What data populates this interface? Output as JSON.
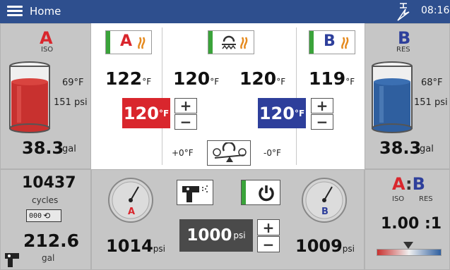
{
  "topbar": {
    "title": "Home",
    "time": "08:16"
  },
  "left_top": {
    "letter": "A",
    "sub": "ISO",
    "temp": "69°F",
    "pressure": "151 psi",
    "volume": "38.3",
    "volume_unit": "gal"
  },
  "right_top": {
    "letter": "B",
    "sub": "RES",
    "temp": "68°F",
    "pressure": "151 psi",
    "volume": "38.3",
    "volume_unit": "gal"
  },
  "center_top": {
    "a_heater_label": "A",
    "b_heater_label": "B",
    "temp_a": "122",
    "temp_hose_a": "120",
    "temp_hose_b": "120",
    "temp_b": "119",
    "unit": "°F",
    "setpoint_a": "120",
    "setpoint_b": "120",
    "plus": "+",
    "minus": "−",
    "offset_a": "+0°F",
    "offset_b": "-0°F"
  },
  "left_bot": {
    "cycles": "10437",
    "cycles_label": "cycles",
    "counter_digits": "000",
    "gallons": "212.6",
    "gallons_label": "gal"
  },
  "center_bot": {
    "gauge_a_letter": "A",
    "gauge_b_letter": "B",
    "pressure_a": "1014",
    "pressure_b": "1009",
    "psi": "psi",
    "setpoint": "1000",
    "setpoint_unit": "psi",
    "plus": "+",
    "minus": "−"
  },
  "right_bot": {
    "a": "A",
    "b": "B",
    "colon": ":",
    "iso": "ISO",
    "res": "RES",
    "ratio": "1.00 :1"
  },
  "colors": {
    "red": "#d9262d",
    "blue": "#2e3f9b",
    "topbar": "#2e4f8e",
    "green": "#3aa33a"
  }
}
